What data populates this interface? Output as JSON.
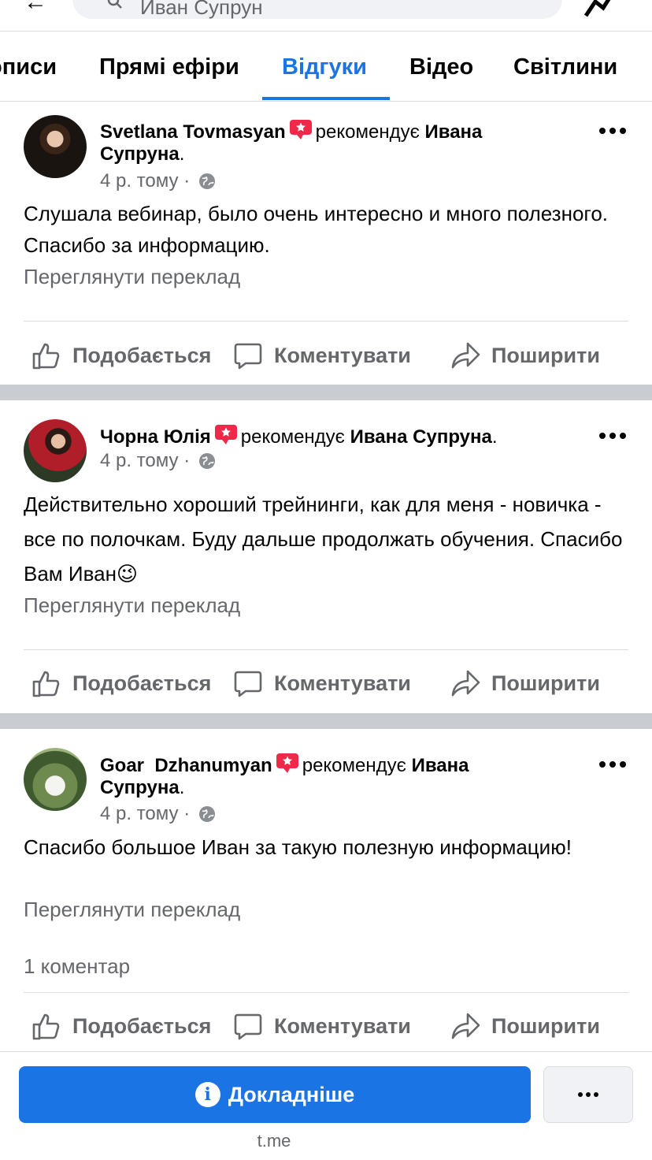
{
  "search": {
    "query": "Иван Супрун"
  },
  "tabs": [
    {
      "label": "Дописи"
    },
    {
      "label": "Прямі ефіри"
    },
    {
      "label": "Відгуки",
      "active": true
    },
    {
      "label": "Відео"
    },
    {
      "label": "Світлини"
    }
  ],
  "colors": {
    "accent": "#1b74e4",
    "badge": "#f02849",
    "muted": "#65676b",
    "separator": "#c9ccd1"
  },
  "reviews": [
    {
      "author": "Svetlana Tovmasyan",
      "recommends": "рекомендує",
      "target": "Ивана Супруна",
      "period": ".",
      "time": "4 р. тому",
      "text": "Слушала вебинар, было очень интересно и много полезного. Спасибо за информацию.",
      "translate": "Переглянути переклад"
    },
    {
      "author": "Чорна Юлія",
      "recommends": "рекомендує",
      "target": "Ивана Супруна",
      "period": ".",
      "time": "4 р. тому",
      "text": "Действительно хороший трейнинги, как для меня - новичка - все по полочкам. Буду дальше продолжать обучения. Спасибо Вам Иван😉",
      "translate": "Переглянути переклад"
    },
    {
      "author": "Goar  Dzhanumyan",
      "recommends": "рекомендує",
      "target": "Ивана Супруна",
      "period": ".",
      "time": "4 р. тому",
      "text": "Спасибо большое Иван за такую полезную информацию!",
      "translate": "Переглянути переклад",
      "comments": "1 коментар"
    }
  ],
  "actions": {
    "like": "Подобається",
    "comment": "Коментувати",
    "share": "Поширити"
  },
  "bottom": {
    "primary_button": "Докладніше",
    "info_glyph": "i",
    "domain": "t.me"
  },
  "icons": [
    "back-arrow-icon",
    "search-icon",
    "messenger-icon",
    "recommend-star-icon",
    "globe-icon",
    "more-icon",
    "like-icon",
    "comment-icon",
    "share-icon",
    "info-icon"
  ]
}
